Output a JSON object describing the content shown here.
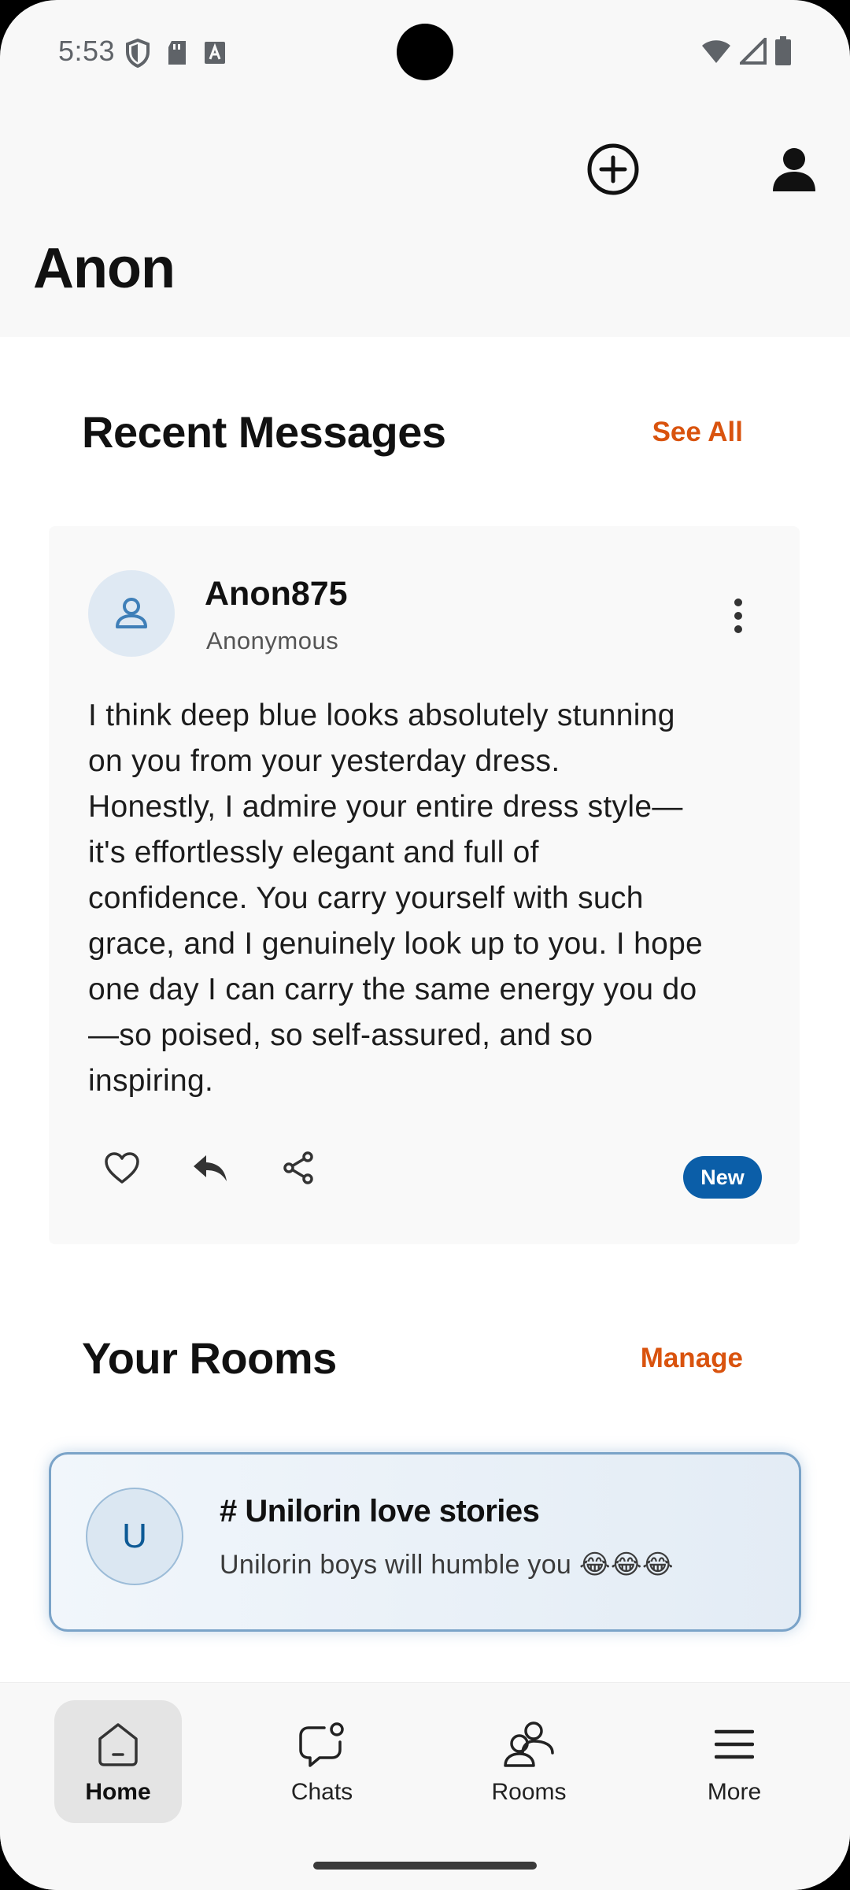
{
  "status_bar": {
    "time": "5:53",
    "icons": [
      "shield-icon",
      "sd-card-icon",
      "font-icon",
      "wifi-icon",
      "signal-icon",
      "battery-icon"
    ]
  },
  "header": {
    "title": "Anon",
    "actions": [
      "add-circle-icon",
      "profile-icon"
    ]
  },
  "recent_messages": {
    "title": "Recent Messages",
    "link": "See All",
    "message": {
      "username": "Anon875",
      "subtitle": "Anonymous",
      "body_lines": [
        "I think deep blue looks absolutely stunning",
        "on you from your yesterday dress.",
        "Honestly, I admire your entire dress style—",
        "it's effortlessly elegant and full of",
        "confidence. You carry yourself with such",
        "grace, and I genuinely look up to you. I hope",
        "one day I can carry the same energy you do",
        "—so poised, so self-assured, and so",
        "inspiring."
      ],
      "badge": "New",
      "actions": [
        "heart-icon",
        "reply-icon",
        "share-icon"
      ]
    }
  },
  "rooms": {
    "title": "Your Rooms",
    "link": "Manage",
    "items": [
      {
        "initial": "U",
        "name": "# Unilorin love stories",
        "preview": "Unilorin boys will humble you 😂😂😂"
      }
    ]
  },
  "bottom_nav": {
    "items": [
      {
        "label": "Home",
        "icon": "home-icon",
        "active": true
      },
      {
        "label": "Chats",
        "icon": "chat-icon",
        "active": false
      },
      {
        "label": "Rooms",
        "icon": "rooms-icon",
        "active": false
      },
      {
        "label": "More",
        "icon": "menu-icon",
        "active": false
      }
    ]
  },
  "colors": {
    "accent_orange": "#d9530e",
    "badge_blue": "#0b5ea8",
    "room_border": "#7aa3c8"
  }
}
